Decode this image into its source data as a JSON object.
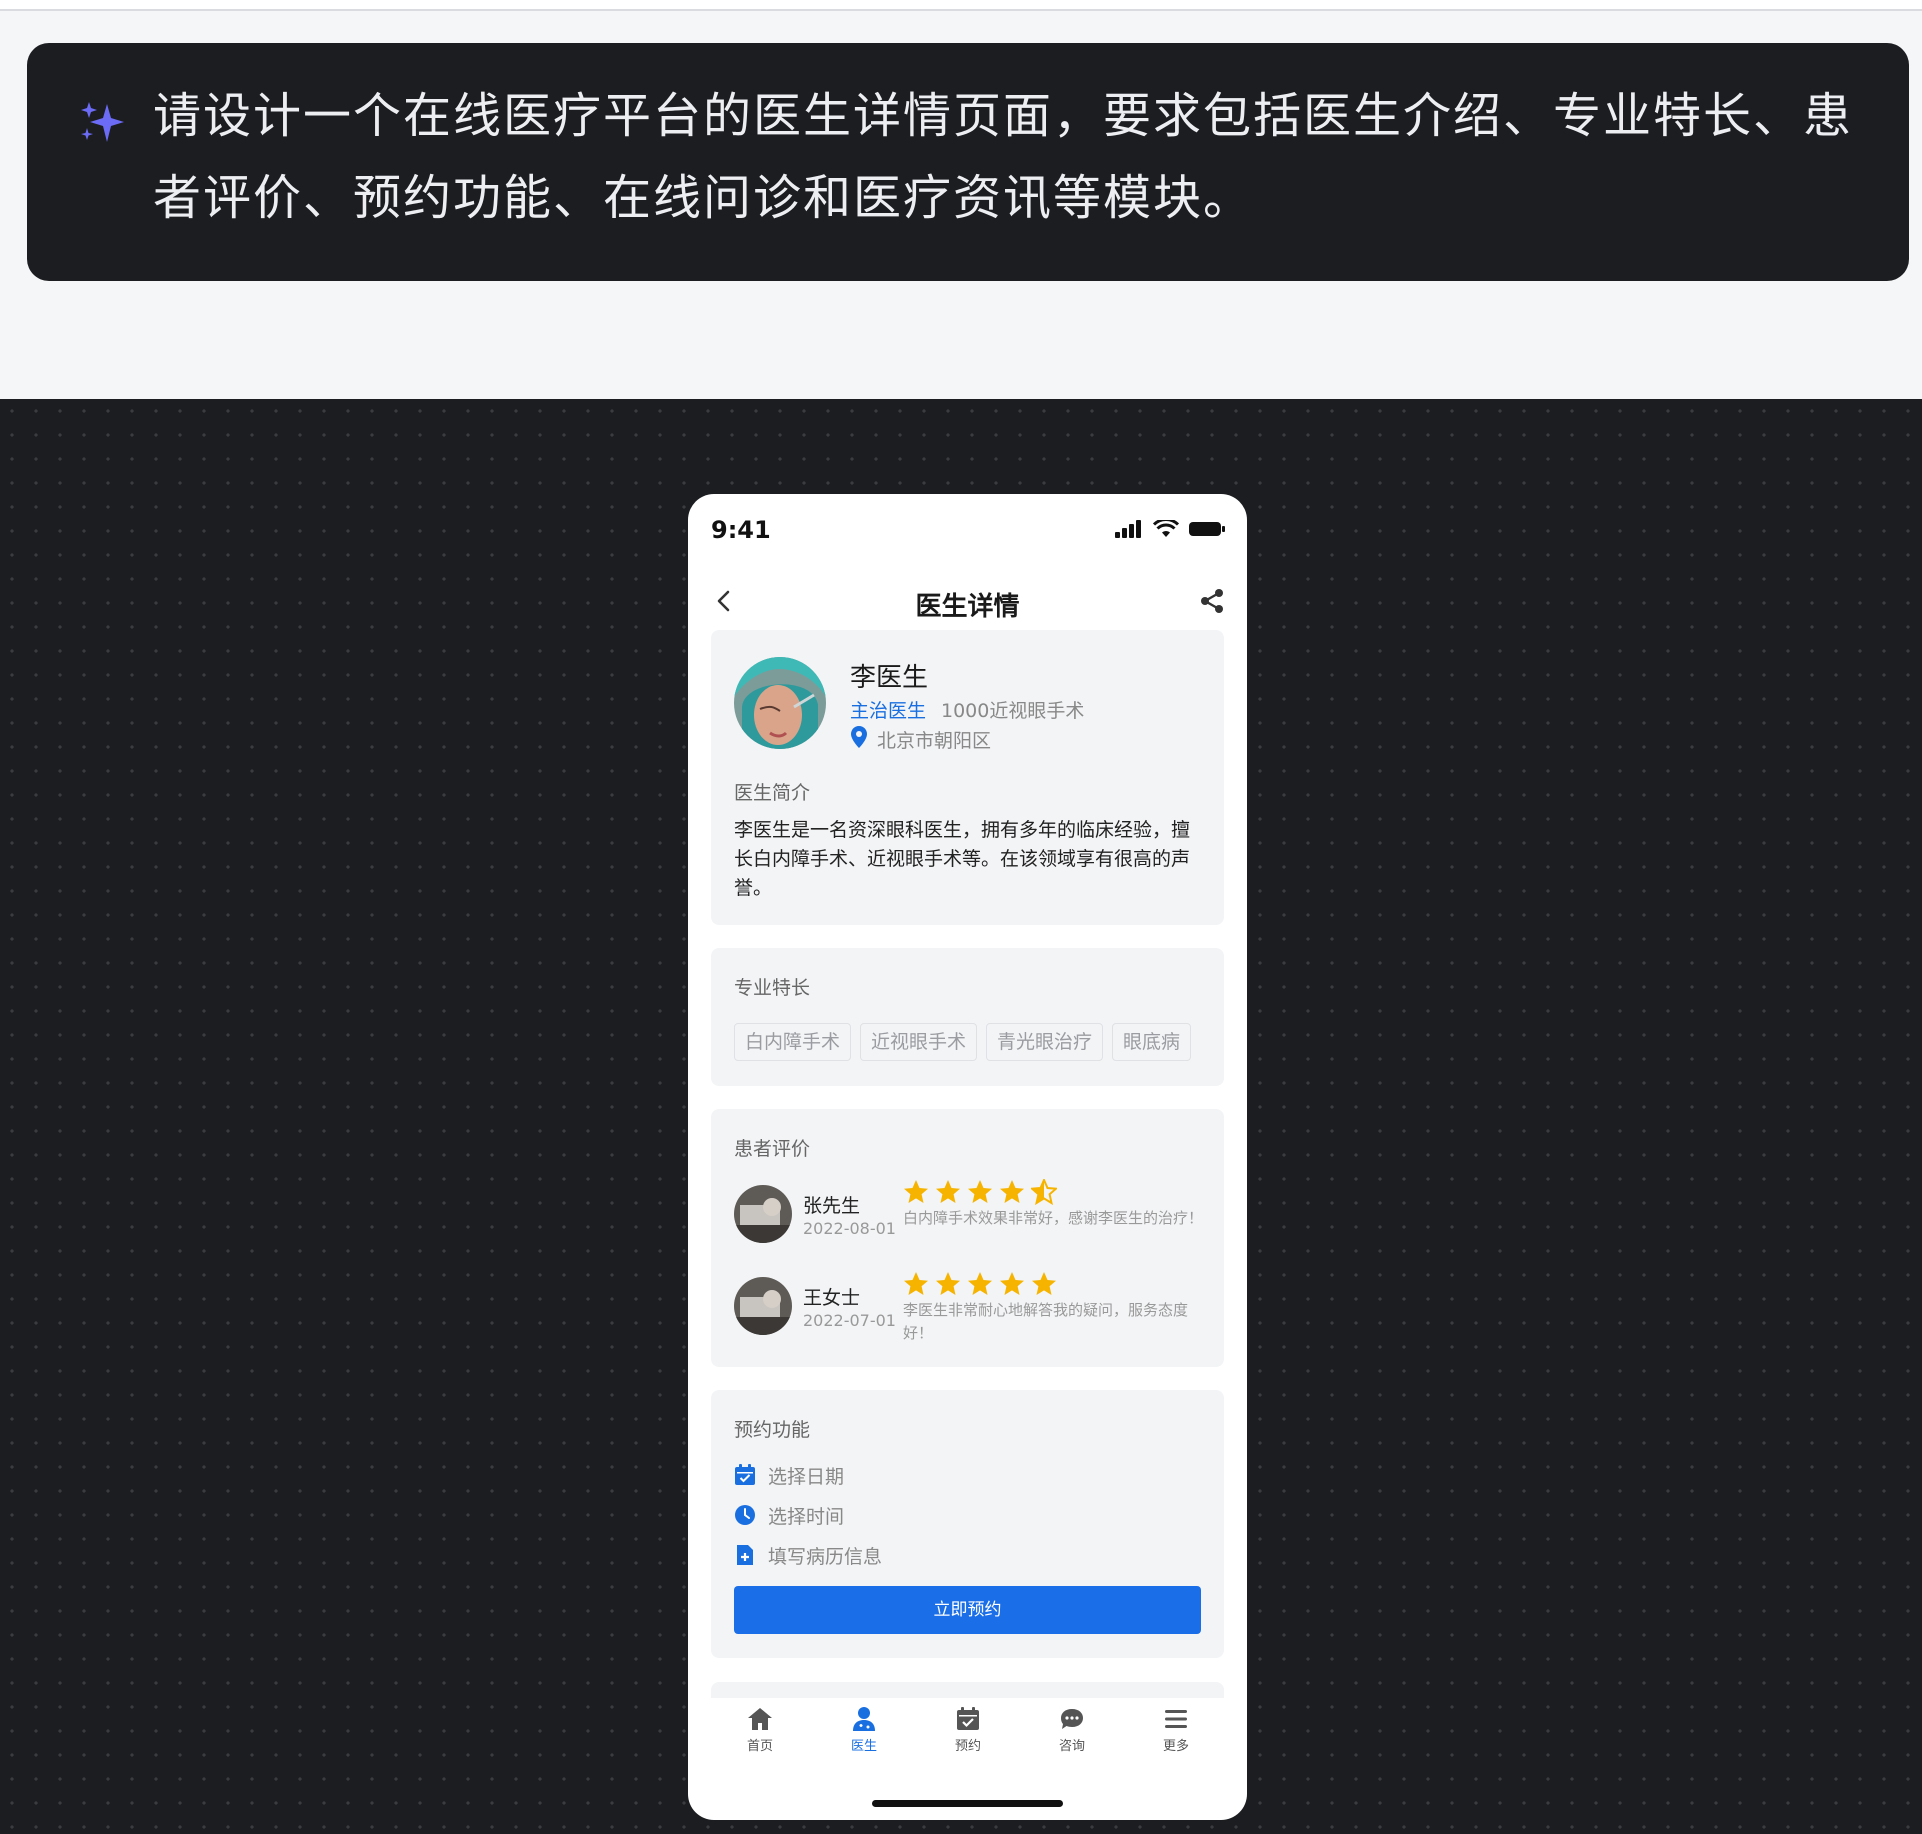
{
  "prompt": {
    "text": "请设计一个在线医疗平台的医生详情页面，要求包括医生介绍、专业特长、患者评价、预约功能、在线问诊和医疗资讯等模块。",
    "icon": "sparkle-icon",
    "accent": "#6b6bf5"
  },
  "status_bar": {
    "time": "9:41"
  },
  "nav": {
    "title": "医生详情"
  },
  "doctor": {
    "name": "李医生",
    "title": "主治医生",
    "experience": "1000近视眼手术",
    "location": "北京市朝阳区",
    "intro_label": "医生简介",
    "intro": "李医生是一名资深眼科医生，拥有多年的临床经验，擅长白内障手术、近视眼手术等。在该领域享有很高的声誉。"
  },
  "specialty": {
    "label": "专业特长",
    "tags": [
      "白内障手术",
      "近视眼手术",
      "青光眼治疗",
      "眼底病"
    ]
  },
  "reviews": {
    "label": "患者评价",
    "items": [
      {
        "name": "张先生",
        "date": "2022-08-01",
        "rating": 4.5,
        "text": "白内障手术效果非常好，感谢李医生的治疗！"
      },
      {
        "name": "王女士",
        "date": "2022-07-01",
        "rating": 5,
        "text": "李医生非常耐心地解答我的疑问，服务态度好！"
      }
    ]
  },
  "booking": {
    "label": "预约功能",
    "options": [
      "选择日期",
      "选择时间",
      "填写病历信息"
    ],
    "button": "立即预约"
  },
  "tabbar": {
    "items": [
      "首页",
      "医生",
      "预约",
      "咨询",
      "更多"
    ],
    "active": "医生"
  },
  "colors": {
    "primary": "#1a6fe0",
    "star": "#f6b400",
    "card_bg": "#f3f4f6",
    "dark_bg": "#1c1d21"
  }
}
